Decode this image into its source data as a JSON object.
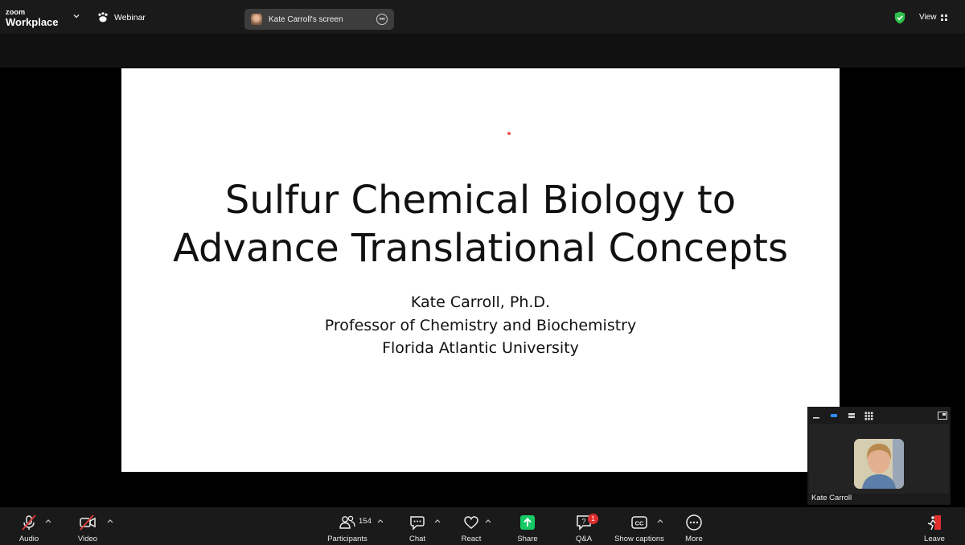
{
  "app": {
    "logo_top": "zoom",
    "logo_bottom": "Workplace",
    "webinar_label": "Webinar",
    "view_label": "View"
  },
  "share_pill": {
    "label": "Kate Carroll's screen"
  },
  "slide": {
    "title_line1": "Sulfur Chemical Biology to",
    "title_line2": "Advance Translational Concepts",
    "presenter": "Kate Carroll, Ph.D.",
    "position": "Professor of Chemistry and Biochemistry",
    "institution": "Florida Atlantic University"
  },
  "self_view": {
    "name": "Kate Carroll"
  },
  "toolbar": {
    "audio": "Audio",
    "video": "Video",
    "participants": "Participants",
    "participant_count": "154",
    "chat": "Chat",
    "react": "React",
    "share": "Share",
    "qa": "Q&A",
    "qa_badge": "1",
    "captions": "Show captions",
    "more": "More",
    "leave": "Leave"
  },
  "colors": {
    "accent_green": "#17c964",
    "shield_green": "#2fbf4a",
    "leave_red": "#e02e2e",
    "muted_red": "#e03a3a",
    "bar_bg": "#1a1a1a"
  }
}
